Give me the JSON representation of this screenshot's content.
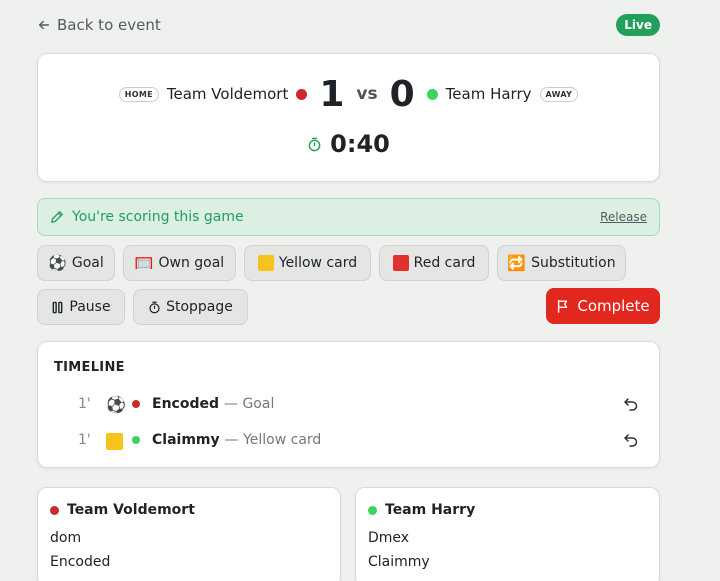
{
  "topbar": {
    "back_label": "Back to event",
    "status": "Live"
  },
  "match": {
    "home_tag": "HOME",
    "home_team": "Team Voldemort",
    "home_score": "1",
    "vs": "vs",
    "away_score": "0",
    "away_team": "Team Harry",
    "away_tag": "AWAY",
    "clock": "0:40"
  },
  "scoring": {
    "message": "You're scoring this game",
    "release_label": "Release"
  },
  "actions": {
    "goal": {
      "icon": "⚽",
      "label": "Goal"
    },
    "own_goal": {
      "icon": "🥅",
      "label": "Own goal"
    },
    "yellow_card": {
      "label": "Yellow card"
    },
    "red_card": {
      "label": "Red card"
    },
    "substitution": {
      "icon": "🔁",
      "label": "Substitution"
    },
    "pause": {
      "label": "Pause"
    },
    "stoppage": {
      "label": "Stoppage"
    },
    "complete": {
      "label": "Complete"
    }
  },
  "timeline": {
    "title": "TIMELINE",
    "events": [
      {
        "minute": "1'",
        "icon": "⚽",
        "player": "Encoded",
        "type": "— Goal"
      },
      {
        "minute": "1'",
        "player": "Claimmy",
        "type": "— Yellow card"
      }
    ]
  },
  "rosters": {
    "home": {
      "team": "Team Voldemort",
      "players": [
        "dom",
        "Encoded"
      ]
    },
    "away": {
      "team": "Team Harry",
      "players": [
        "Dmex",
        "Claimmy"
      ]
    }
  },
  "colors": {
    "accent_green": "#22a05b",
    "home_dot": "#cc2a2a",
    "away_dot": "#3cd45c",
    "complete_red": "#e2271f",
    "yellow_card": "#f8c21d",
    "red_card": "#e2302f"
  }
}
